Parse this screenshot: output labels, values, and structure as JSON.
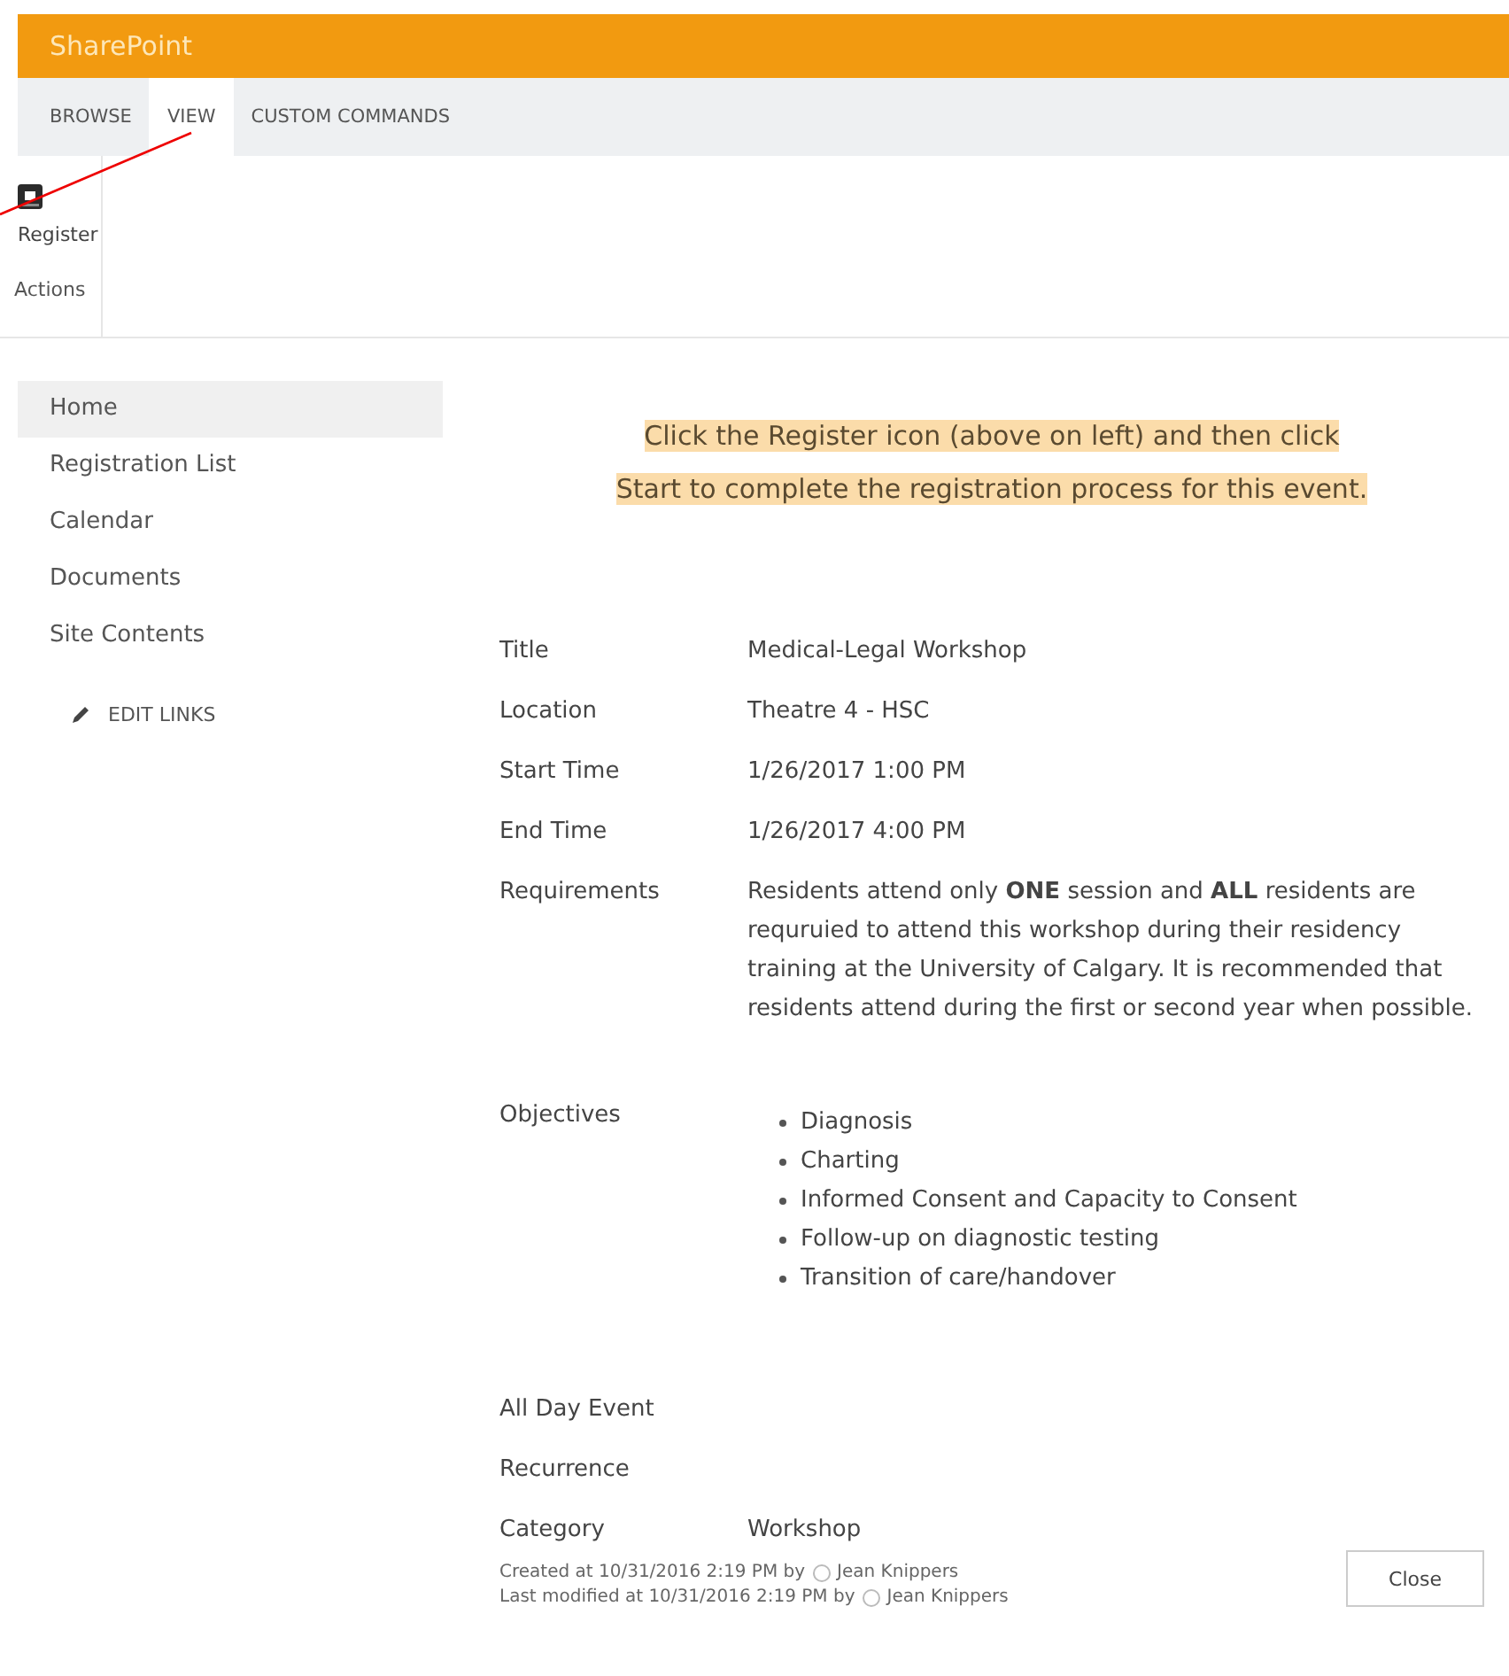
{
  "brand": "SharePoint",
  "tabs": [
    {
      "label": "BROWSE",
      "selected": false
    },
    {
      "label": "VIEW",
      "selected": true
    },
    {
      "label": "CUSTOM COMMANDS",
      "selected": false
    }
  ],
  "ribbon": {
    "button": "Register",
    "group": "Actions"
  },
  "nav": {
    "items": [
      {
        "label": "Home",
        "selected": true
      },
      {
        "label": "Registration List",
        "selected": false
      },
      {
        "label": "Calendar",
        "selected": false
      },
      {
        "label": "Documents",
        "selected": false
      },
      {
        "label": "Site Contents",
        "selected": false
      }
    ],
    "edit_links": "EDIT LINKS"
  },
  "notice": [
    "Click the Register icon (above on left) and then click",
    "Start to complete the registration process for this event."
  ],
  "fields": [
    {
      "kind": "text",
      "label": "Title",
      "value": "Medical-Legal Workshop"
    },
    {
      "kind": "text",
      "label": "Location",
      "value": "Theatre 4 - HSC"
    },
    {
      "kind": "text",
      "label": "Start Time",
      "value": "1/26/2017 1:00 PM"
    },
    {
      "kind": "text",
      "label": "End Time",
      "value": "1/26/2017 4:00 PM"
    },
    {
      "kind": "paragraph",
      "label": "Requirements",
      "value": "Residents attend only **ONE** session and **ALL** residents are requruied to attend this workshop during their residency training at the University of Calgary.  It is recommended that residents attend during the first or second year when possible."
    },
    {
      "kind": "list",
      "label": "Objectives",
      "items": [
        "Diagnosis",
        "Charting",
        "Informed Consent and Capacity to Consent",
        "Follow-up on diagnostic testing",
        "Transition of care/handover"
      ]
    },
    {
      "kind": "text",
      "label": "All Day Event"
    },
    {
      "kind": "text",
      "label": "Recurrence"
    },
    {
      "kind": "text",
      "label": "Category",
      "value": "Workshop"
    }
  ],
  "footer": {
    "created_prefix": "Created at 10/31/2016 2:19 PM by",
    "created_by": "Jean Knippers",
    "modified_prefix": "Last modified at 10/31/2016 2:19 PM by",
    "modified_by": "Jean Knippers",
    "close": "Close"
  }
}
